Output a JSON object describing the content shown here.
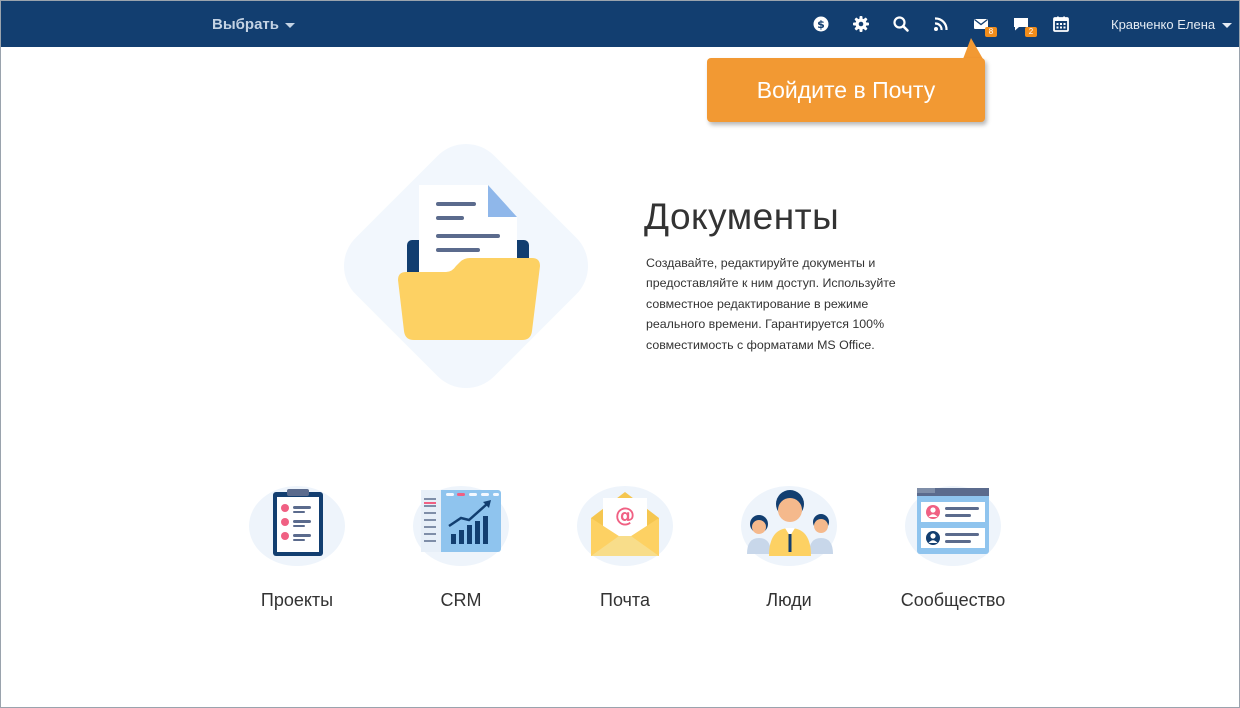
{
  "header": {
    "select_label": "Выбрать",
    "user_name": "Кравченко Елена",
    "icons": [
      {
        "name": "payment-icon"
      },
      {
        "name": "settings-icon"
      },
      {
        "name": "search-icon"
      },
      {
        "name": "feed-icon"
      },
      {
        "name": "mail-icon",
        "badge": "8"
      },
      {
        "name": "chat-icon",
        "badge": "2"
      },
      {
        "name": "calendar-icon"
      }
    ],
    "colors": {
      "bar": "#123e70",
      "badge": "#f28d1b"
    }
  },
  "callout": {
    "text": "Войдите в Почту",
    "color": "#f29933"
  },
  "hero": {
    "title": "Документы",
    "description": "Создавайте, редактируйте документы и предоставляйте к ним доступ. Используйте совместное редактирование в режиме реального времени. Гарантируется 100% совместимость с форматами MS Office.",
    "illustration": "documents-folder-icon"
  },
  "modules": [
    {
      "label": "Проекты",
      "icon": "projects-icon"
    },
    {
      "label": "CRM",
      "icon": "crm-icon"
    },
    {
      "label": "Почта",
      "icon": "mail-envelope-icon"
    },
    {
      "label": "Люди",
      "icon": "people-icon"
    },
    {
      "label": "Сообщество",
      "icon": "community-icon"
    }
  ]
}
